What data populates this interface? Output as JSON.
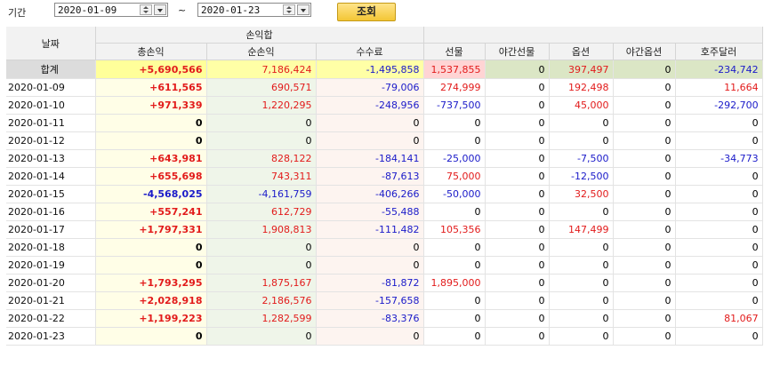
{
  "toolbar": {
    "period_label": "기간",
    "date_from": "2020-01-09",
    "date_to": "2020-01-23",
    "separator": "~",
    "query_button": "조회"
  },
  "table": {
    "group_header": "손익합",
    "headers": [
      "날짜",
      "총손익",
      "순손익",
      "수수료",
      "선물",
      "야간선물",
      "옵션",
      "야간옵션",
      "호주달러"
    ],
    "summary": [
      "합계",
      "+5,690,566",
      "7,186,424",
      "-1,495,858",
      "1,537,855",
      "0",
      "397,497",
      "0",
      "-234,742"
    ],
    "rows": [
      [
        "2020-01-09",
        "+611,565",
        "690,571",
        "-79,006",
        "274,999",
        "0",
        "192,498",
        "0",
        "11,664"
      ],
      [
        "2020-01-10",
        "+971,339",
        "1,220,295",
        "-248,956",
        "-737,500",
        "0",
        "45,000",
        "0",
        "-292,700"
      ],
      [
        "2020-01-11",
        "0",
        "0",
        "0",
        "0",
        "0",
        "0",
        "0",
        "0"
      ],
      [
        "2020-01-12",
        "0",
        "0",
        "0",
        "0",
        "0",
        "0",
        "0",
        "0"
      ],
      [
        "2020-01-13",
        "+643,981",
        "828,122",
        "-184,141",
        "-25,000",
        "0",
        "-7,500",
        "0",
        "-34,773"
      ],
      [
        "2020-01-14",
        "+655,698",
        "743,311",
        "-87,613",
        "75,000",
        "0",
        "-12,500",
        "0",
        "0"
      ],
      [
        "2020-01-15",
        "-4,568,025",
        "-4,161,759",
        "-406,266",
        "-50,000",
        "0",
        "32,500",
        "0",
        "0"
      ],
      [
        "2020-01-16",
        "+557,241",
        "612,729",
        "-55,488",
        "0",
        "0",
        "0",
        "0",
        "0"
      ],
      [
        "2020-01-17",
        "+1,797,331",
        "1,908,813",
        "-111,482",
        "105,356",
        "0",
        "147,499",
        "0",
        "0"
      ],
      [
        "2020-01-18",
        "0",
        "0",
        "0",
        "0",
        "0",
        "0",
        "0",
        "0"
      ],
      [
        "2020-01-19",
        "0",
        "0",
        "0",
        "0",
        "0",
        "0",
        "0",
        "0"
      ],
      [
        "2020-01-20",
        "+1,793,295",
        "1,875,167",
        "-81,872",
        "1,895,000",
        "0",
        "0",
        "0",
        "0"
      ],
      [
        "2020-01-21",
        "+2,028,918",
        "2,186,576",
        "-157,658",
        "0",
        "0",
        "0",
        "0",
        "0"
      ],
      [
        "2020-01-22",
        "+1,199,223",
        "1,282,599",
        "-83,376",
        "0",
        "0",
        "0",
        "0",
        "81,067"
      ],
      [
        "2020-01-23",
        "0",
        "0",
        "0",
        "0",
        "0",
        "0",
        "0",
        "0"
      ]
    ]
  }
}
